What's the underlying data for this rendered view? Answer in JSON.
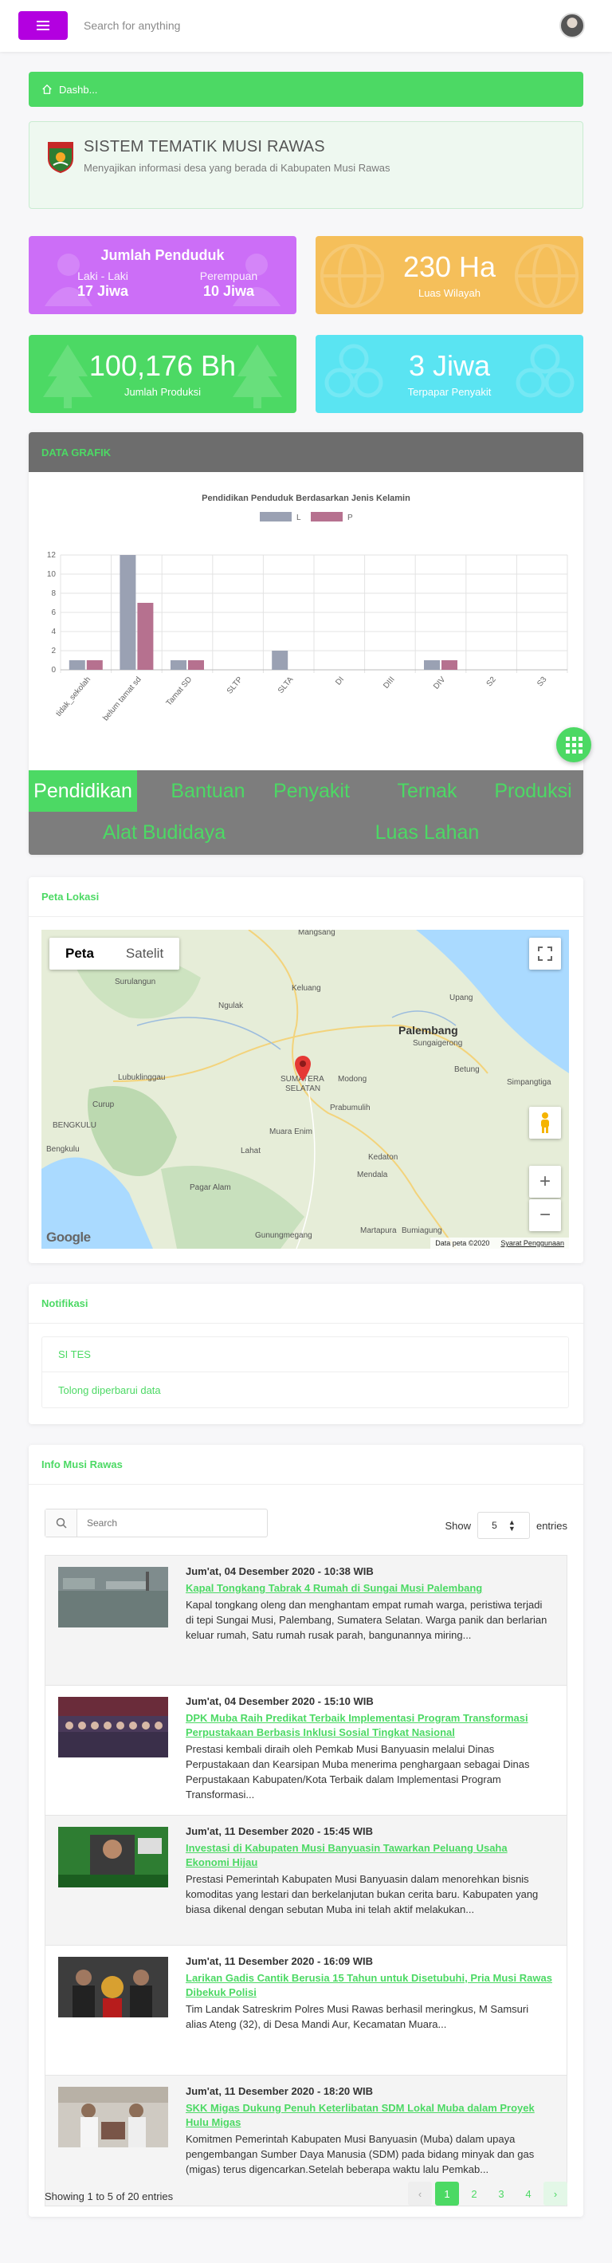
{
  "topbar": {
    "search_placeholder": "Search for anything"
  },
  "breadcrumb": {
    "label": "Dashb..."
  },
  "header": {
    "title": "SISTEM TEMATIK MUSI RAWAS",
    "subtitle": "Menyajikan informasi desa yang berada di Kabupaten Musi Rawas"
  },
  "stats": {
    "penduduk": {
      "title": "Jumlah Penduduk",
      "male_label": "Laki - Laki",
      "male_value": "17 Jiwa",
      "female_label": "Perempuan",
      "female_value": "10 Jiwa"
    },
    "luas": {
      "value": "230 Ha",
      "label": "Luas Wilayah"
    },
    "produksi": {
      "value": "100,176 Bh",
      "label": "Jumlah Produksi"
    },
    "penyakit": {
      "value": "3 Jiwa",
      "label": "Terpapar Penyakit"
    }
  },
  "chart_panel": {
    "header": "DATA GRAFIK"
  },
  "chart_data": {
    "type": "bar",
    "title": "Pendidikan Penduduk Berdasarkan Jenis Kelamin",
    "categories": [
      "tidak_sekolah",
      "belum tamat sd",
      "Tamat SD",
      "SLTP",
      "SLTA",
      "DI",
      "DIII",
      "DIV",
      "S2",
      "S3"
    ],
    "series": [
      {
        "name": "L",
        "values": [
          1,
          12,
          1,
          0,
          2,
          0,
          0,
          1,
          0,
          0
        ],
        "color": "#9aa1b3"
      },
      {
        "name": "P",
        "values": [
          1,
          7,
          1,
          0,
          0,
          0,
          0,
          1,
          0,
          0
        ],
        "color": "#b6718f"
      }
    ],
    "ylim": [
      0,
      12
    ],
    "yticks": [
      0,
      2,
      4,
      6,
      8,
      10,
      12
    ],
    "grid": true,
    "legend": "top-center"
  },
  "tabs": [
    "Pendidikan",
    "Bantuan",
    "Penyakit",
    "Ternak",
    "Produksi",
    "Alat Budidaya",
    "Luas Lahan"
  ],
  "map_panel": {
    "title": "Peta Lokasi",
    "toggle_map": "Peta",
    "toggle_sat": "Satelit",
    "labels": [
      "Mangsang",
      "Surulangun",
      "Keluang",
      "Ngulak",
      "Palembang",
      "Sungaigerong",
      "Upang",
      "Betung",
      "Lubuklinggau",
      "SUMATERA",
      "SELATAN",
      "Modong",
      "Simpangtiga",
      "Prabumulih",
      "Curup",
      "Muara Enim",
      "BENGKULU",
      "Bengkulu",
      "Lahat",
      "Kedaton",
      "Mendala",
      "Pagar Alam",
      "Gunungmegang",
      "Martapura",
      "Bumiagung"
    ],
    "attribution": "Data peta ©2020",
    "terms": "Syarat Penggunaan",
    "logo": "Google"
  },
  "notif_panel": {
    "title": "Notifikasi",
    "items": [
      "SI TES",
      "Tolong diperbarui data"
    ]
  },
  "news_panel": {
    "title": "Info Musi Rawas",
    "search_placeholder": "Search",
    "show_label": "Show",
    "show_value": "5",
    "entries_label": "entries",
    "items": [
      {
        "date": "Jum'at, 04 Desember 2020 - 10:38 WIB",
        "title": "Kapal Tongkang Tabrak 4 Rumah di Sungai Musi Palembang",
        "body": "Kapal tongkang oleng dan menghantam empat rumah warga, peristiwa terjadi di tepi Sungai Musi, Palembang, Sumatera Selatan. Warga panik dan berlarian keluar rumah, Satu rumah rusak parah, bangunannya miring..."
      },
      {
        "date": "Jum'at, 04 Desember 2020 - 15:10 WIB",
        "title": "DPK Muba Raih Predikat Terbaik Implementasi Program Transformasi Perpustakaan Berbasis Inklusi Sosial Tingkat Nasional",
        "body": "Prestasi kembali diraih oleh Pemkab Musi Banyuasin melalui Dinas Perpustakaan dan Kearsipan Muba menerima penghargaan sebagai Dinas Perpustakaan Kabupaten/Kota Terbaik dalam Implementasi Program Transformasi..."
      },
      {
        "date": "Jum'at, 11 Desember 2020 - 15:45 WIB",
        "title": "Investasi di Kabupaten Musi Banyuasin Tawarkan Peluang Usaha Ekonomi Hijau",
        "body": "Prestasi Pemerintah Kabupaten Musi Banyuasin dalam menorehkan bisnis komoditas yang lestari dan berkelanjutan bukan cerita baru. Kabupaten yang biasa dikenal dengan sebutan Muba ini telah aktif melakukan..."
      },
      {
        "date": "Jum'at, 11 Desember 2020 - 16:09 WIB",
        "title": "Larikan Gadis Cantik Berusia 15 Tahun untuk Disetubuhi, Pria Musi Rawas Dibekuk Polisi",
        "body": "Tim Landak Satreskrim Polres Musi Rawas berhasil meringkus, M Samsuri alias Ateng (32), di Desa Mandi Aur, Kecamatan Muara..."
      },
      {
        "date": "Jum'at, 11 Desember 2020 - 18:20 WIB",
        "title": "SKK Migas Dukung Penuh Keterlibatan SDM Lokal Muba dalam Proyek Hulu Migas",
        "body": "Komitmen Pemerintah Kabupaten Musi Banyuasin (Muba) dalam upaya pengembangan Sumber Daya Manusia (SDM) pada bidang minyak dan gas (migas) terus digencarkan.Setelah beberapa waktu lalu Pemkab..."
      }
    ],
    "info": "Showing 1 to 5 of 20 entries",
    "pages": [
      "1",
      "2",
      "3",
      "4"
    ],
    "current_page": "1",
    "prev_icon": "chevron-left-icon",
    "next_icon": "chevron-right-icon"
  },
  "colors": {
    "accent": "#4cd964",
    "menu": "#b300e0",
    "card_purple": "#cc6ef7",
    "card_orange": "#f5bf5a",
    "card_green": "#4cd964",
    "card_cyan": "#5ae4f2"
  }
}
